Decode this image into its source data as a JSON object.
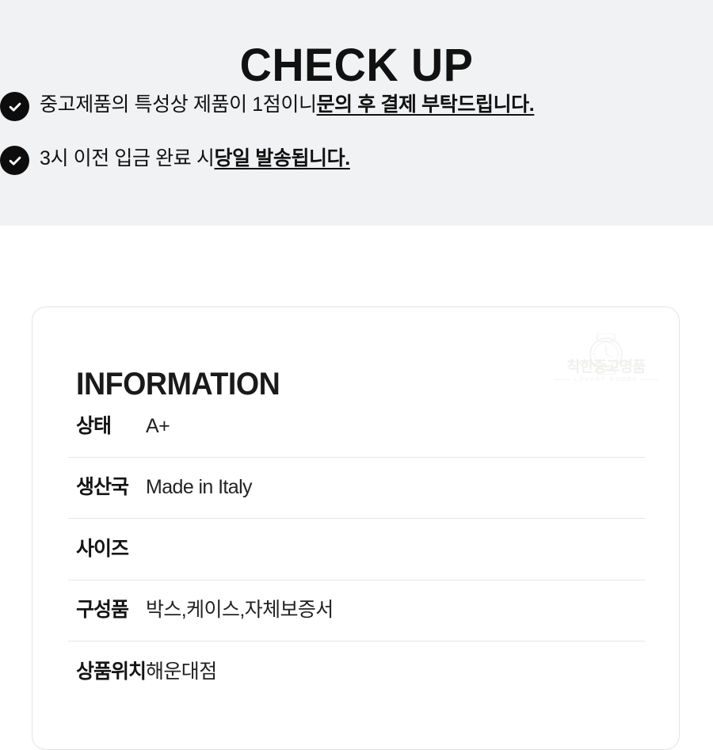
{
  "checkup": {
    "title": "CHECK UP",
    "accent_color": "#0d0d0d",
    "panel_bg": "#f1f2f4",
    "items": [
      {
        "icon": "check-circle-icon",
        "plain": "중고제품의 특성상 제품이 1점이니 ",
        "strong": "문의 후 결제 부탁드립니다."
      },
      {
        "icon": "check-circle-icon",
        "plain": "3시 이전 입금 완료 시 ",
        "strong": "당일 발송됩니다."
      }
    ]
  },
  "information": {
    "title": "INFORMATION",
    "watermark": {
      "icon": "watch-icon",
      "brand": "착한중고명품",
      "sub": "LUXURY GOODS"
    },
    "rows": [
      {
        "label": "상태",
        "value": "A+"
      },
      {
        "label": "생산국",
        "value": "Made in Italy"
      },
      {
        "label": "사이즈",
        "value": ""
      },
      {
        "label": "구성품",
        "value": "박스,케이스,자체보증서"
      },
      {
        "label": "상품위치",
        "value": "해운대점"
      }
    ]
  }
}
